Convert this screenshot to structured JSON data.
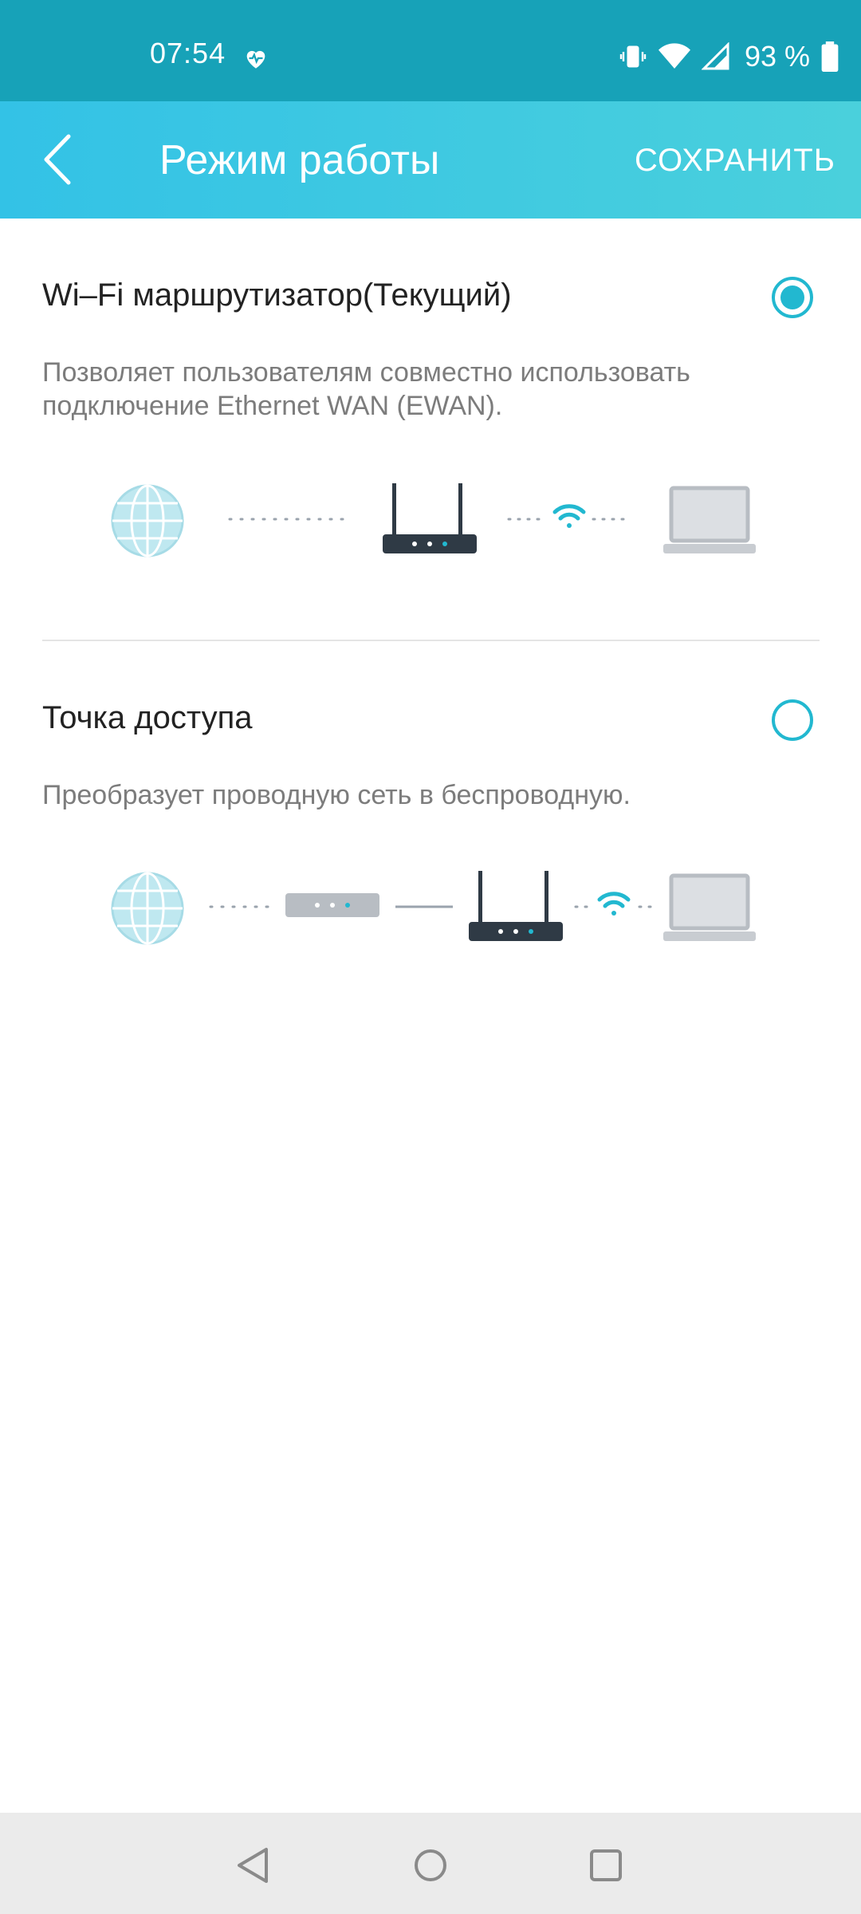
{
  "status_bar": {
    "time": "07:54",
    "battery": "93 %"
  },
  "app_bar": {
    "title": "Режим работы",
    "save_label": "СОХРАНИТЬ"
  },
  "options": [
    {
      "title": "Wi–Fi маршрутизатор(Текущий)",
      "description": "Позволяет пользователям совместно использовать подключение Ethernet WAN (EWAN).",
      "selected": true
    },
    {
      "title": "Точка доступа",
      "description": "Преобразует проводную сеть в беспроводную.",
      "selected": false
    }
  ],
  "colors": {
    "accent": "#22b8d0",
    "status_bar": "#17a2b8",
    "router": "#2f3a45"
  },
  "icons": [
    "back-icon",
    "heart-icon",
    "vibrate-icon",
    "wifi-icon",
    "signal-icon",
    "battery-icon",
    "globe-icon",
    "router-icon",
    "modem-icon",
    "laptop-icon",
    "nav-back-icon",
    "nav-home-icon",
    "nav-recents-icon"
  ]
}
